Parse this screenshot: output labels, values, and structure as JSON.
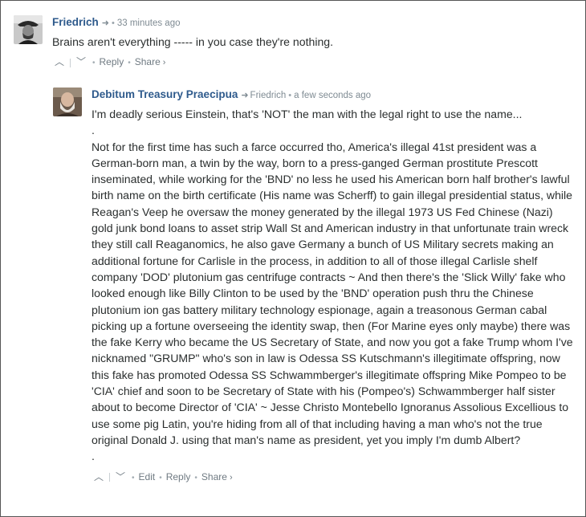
{
  "comments": [
    {
      "author": "Friedrich",
      "reply_to": "",
      "time": "33 minutes ago",
      "paragraphs": [
        "Brains aren't everything ----- in you case they're nothing."
      ],
      "actions": {
        "reply": "Reply",
        "share": "Share"
      }
    },
    {
      "author": "Debitum Treasury Praecipua",
      "reply_to": "Friedrich",
      "time": "a few seconds ago",
      "paragraphs": [
        "I'm deadly serious Einstein, that's 'NOT' the man with the legal right to use the name...",
        ".",
        "Not for the first time has such a farce occurred tho, America's illegal 41st president was a German-born man, a twin by the way, born to a press-ganged German prostitute Prescott inseminated, while working for the 'BND' no less he used his American born half brother's lawful birth name on the birth certificate (His name was Scherff) to gain illegal presidential status, while Reagan's Veep he oversaw the money generated by the illegal 1973 US Fed Chinese (Nazi) gold junk bond loans to asset strip Wall St and American industry in that unfortunate train wreck they still call Reaganomics, he also gave Germany a bunch of US Military secrets making an additional fortune for Carlisle in the process, in addition to all of those illegal Carlisle shelf company 'DOD' plutonium gas centrifuge contracts ~ And then there's the 'Slick Willy' fake who looked enough like Billy Clinton to be used by the 'BND' operation push thru the Chinese plutonium ion gas battery military technology espionage, again a treasonous German cabal picking up a fortune overseeing the identity swap, then (For Marine eyes only maybe) there was the fake Kerry who became the US Secretary of State, and now you got a fake Trump whom I've nicknamed \"GRUMP\" who's son in law is Odessa SS Kutschmann's illegitimate offspring, now this fake has promoted Odessa SS Schwammberger's illegitimate offspring Mike Pompeo to be 'CIA' chief and soon to be Secretary of State with his (Pompeo's) Schwammberger half sister about to become Director of 'CIA' ~ Jesse Christo Montebello Ignoranus Assolious Excellious to use some pig Latin, you're hiding from all of that including having a man who's not the true original Donald J. using that man's name as president, yet you imply I'm dumb Albert?",
        "."
      ],
      "actions": {
        "edit": "Edit",
        "reply": "Reply",
        "share": "Share"
      }
    }
  ],
  "icons": {
    "reply_arrow": "share-arrow-icon",
    "upvote": "chevron-up-icon",
    "downvote": "chevron-down-icon",
    "share_chevron": "chevron-right-icon"
  },
  "colors": {
    "author_link": "#2e5a8c",
    "meta_text": "#7f8b93",
    "body_text": "#2a2e2e"
  }
}
